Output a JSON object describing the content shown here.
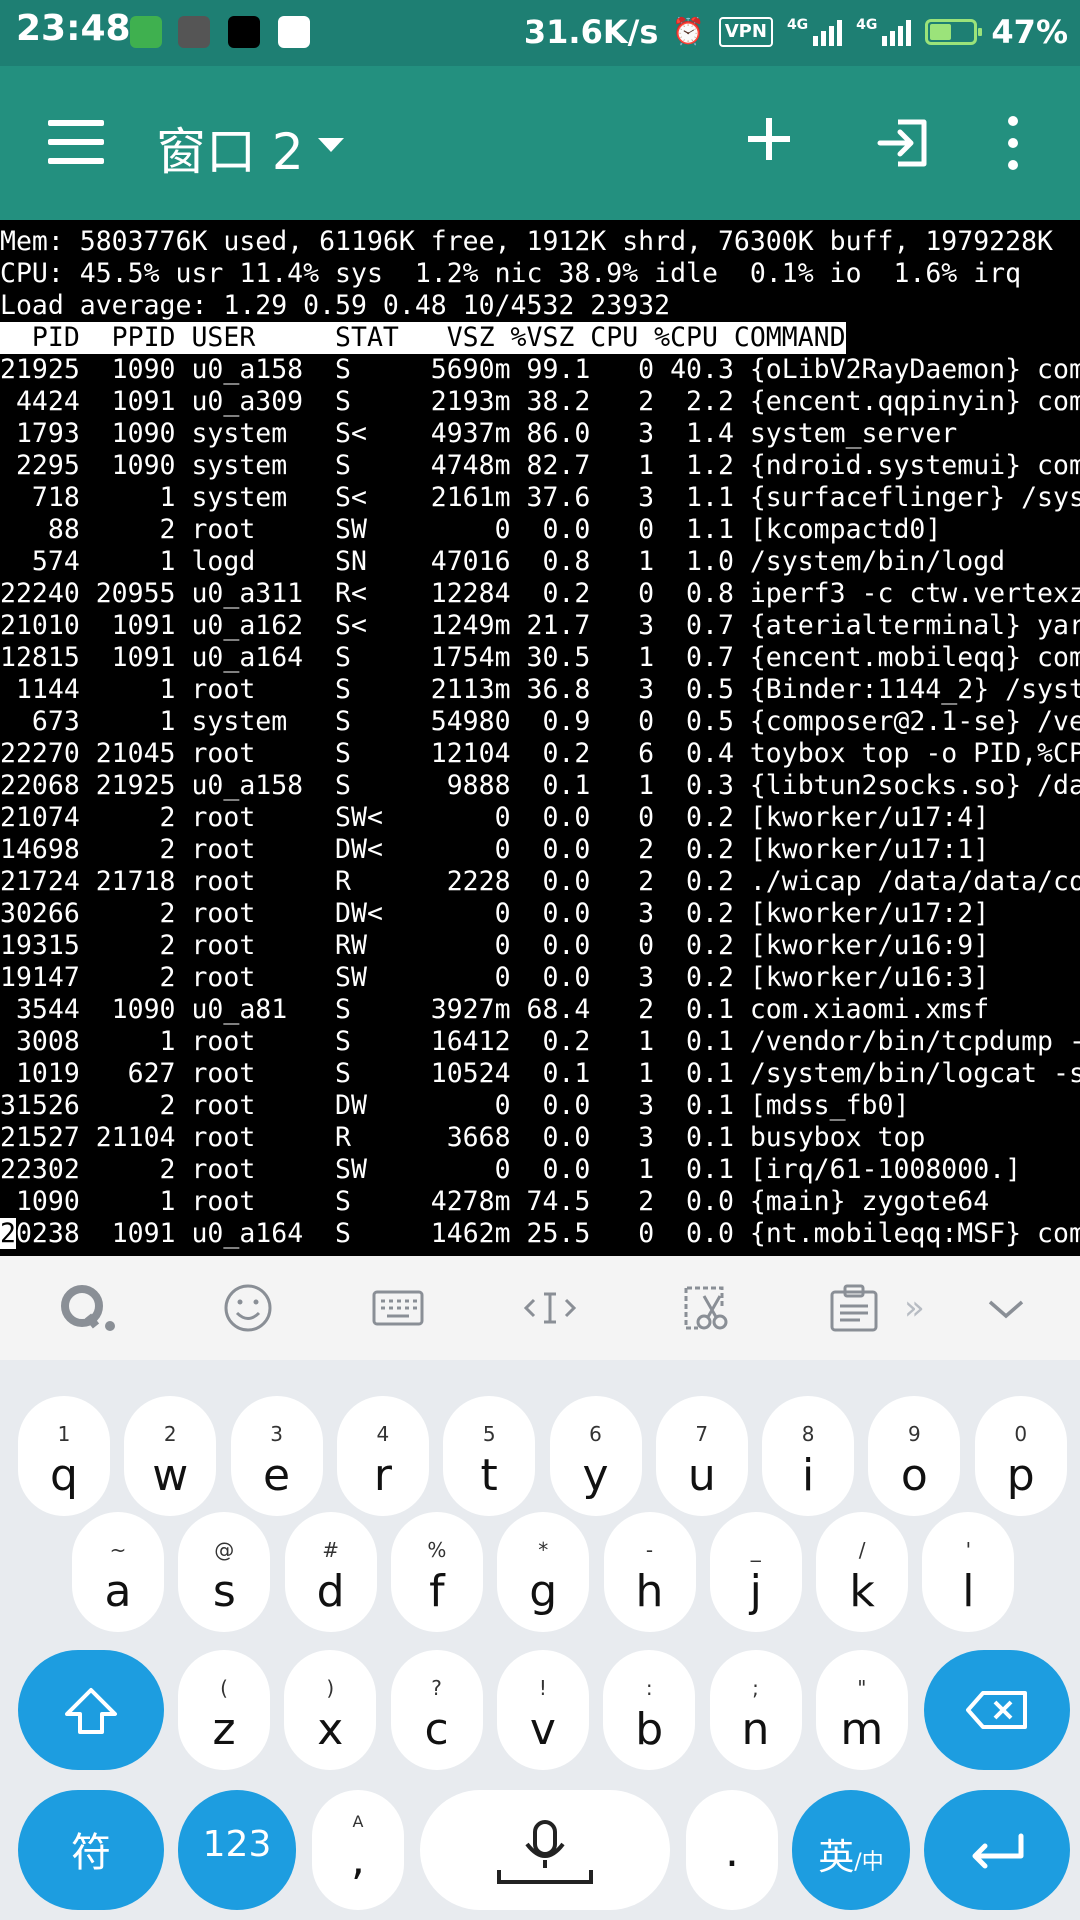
{
  "status_bar": {
    "time": "23:48",
    "network_speed": "31.6K/s",
    "vpn": "VPN",
    "sim1": "4G",
    "sim2": "4G",
    "battery": "47%",
    "battery_level": 0.47
  },
  "toolbar": {
    "title": "窗口 2"
  },
  "terminal": {
    "mem_line": "Mem: 5803776K used, 61196K free, 1912K shrd, 76300K buff, 1979228K",
    "cpu_line": "CPU: 45.5% usr 11.4% sys  1.2% nic 38.9% idle  0.1% io  1.6% irq",
    "load_line": "Load average: 1.29 0.59 0.48 10/4532 23932",
    "header": "  PID  PPID USER     STAT   VSZ %VSZ CPU %CPU COMMAND",
    "rows": [
      "21925  1090 u0_a158  S     5690m 99.1   0 40.3 {oLibV2RayDaemon} com",
      " 4424  1091 u0_a309  S     2193m 38.2   2  2.2 {encent.qqpinyin} com",
      " 1793  1090 system   S<    4937m 86.0   3  1.4 system_server",
      " 2295  1090 system   S     4748m 82.7   1  1.2 {ndroid.systemui} com",
      "  718     1 system   S<    2161m 37.6   3  1.1 {surfaceflinger} /sys",
      "   88     2 root     SW        0  0.0   0  1.1 [kcompactd0]",
      "  574     1 logd     SN    47016  0.8   1  1.0 /system/bin/logd",
      "22240 20955 u0_a311  R<    12284  0.2   0  0.8 iperf3 -c ctw.vertexz",
      "21010  1091 u0_a162  S<    1249m 21.7   3  0.7 {aterialterminal} yar",
      "12815  1091 u0_a164  S     1754m 30.5   1  0.7 {encent.mobileqq} com",
      " 1144     1 root     S     2113m 36.8   3  0.5 {Binder:1144_2} /syst",
      "  673     1 system   S     54980  0.9   0  0.5 {composer@2.1-se} /ve",
      "22270 21045 root     S     12104  0.2   6  0.4 toybox top -o PID,%CP",
      "22068 21925 u0_a158  S      9888  0.1   1  0.3 {libtun2socks.so} /da",
      "21074     2 root     SW<       0  0.0   0  0.2 [kworker/u17:4]",
      "14698     2 root     DW<       0  0.0   2  0.2 [kworker/u17:1]",
      "21724 21718 root     R      2228  0.0   2  0.2 ./wicap /data/data/co",
      "30266     2 root     DW<       0  0.0   3  0.2 [kworker/u17:2]",
      "19315     2 root     RW        0  0.0   0  0.2 [kworker/u16:9]",
      "19147     2 root     SW        0  0.0   3  0.2 [kworker/u16:3]",
      " 3544  1090 u0_a81   S     3927m 68.4   2  0.1 com.xiaomi.xmsf",
      " 3008     1 root     S     16412  0.2   1  0.1 /vendor/bin/tcpdump -",
      " 1019   627 root     S     10524  0.1   1  0.1 /system/bin/logcat -s",
      "31526     2 root     DW        0  0.0   3  0.1 [mdss_fb0]",
      "21527 21104 root     R      3668  0.0   3  0.1 busybox top",
      "22302     2 root     SW        0  0.0   1  0.1 [irq/61-1008000.]",
      " 1090     1 root     S     4278m 74.5   2  0.0 {main} zygote64"
    ],
    "last_row_cursor": "2",
    "last_row_rest": "0238  1091 u0_a164  S     1462m 25.5   0  0.0 {nt.mobileqq:MSF} com"
  },
  "keyboard": {
    "row1": [
      {
        "sub": "1",
        "key": "q"
      },
      {
        "sub": "2",
        "key": "w"
      },
      {
        "sub": "3",
        "key": "e"
      },
      {
        "sub": "4",
        "key": "r"
      },
      {
        "sub": "5",
        "key": "t"
      },
      {
        "sub": "6",
        "key": "y"
      },
      {
        "sub": "7",
        "key": "u"
      },
      {
        "sub": "8",
        "key": "i"
      },
      {
        "sub": "9",
        "key": "o"
      },
      {
        "sub": "0",
        "key": "p"
      }
    ],
    "row2": [
      {
        "sub": "~",
        "key": "a"
      },
      {
        "sub": "@",
        "key": "s"
      },
      {
        "sub": "#",
        "key": "d"
      },
      {
        "sub": "%",
        "key": "f"
      },
      {
        "sub": "*",
        "key": "g"
      },
      {
        "sub": "-",
        "key": "h"
      },
      {
        "sub": "_",
        "key": "j"
      },
      {
        "sub": "/",
        "key": "k"
      },
      {
        "sub": "'",
        "key": "l"
      }
    ],
    "row3": [
      {
        "sub": "(",
        "key": "z"
      },
      {
        "sub": ")",
        "key": "x"
      },
      {
        "sub": "?",
        "key": "c"
      },
      {
        "sub": "!",
        "key": "v"
      },
      {
        "sub": ":",
        "key": "b"
      },
      {
        "sub": ";",
        "key": "n"
      },
      {
        "sub": "\"",
        "key": "m"
      }
    ],
    "symbol_key": "符",
    "num_key": "123",
    "comma_key": ",",
    "comma_sub": "A",
    "period_key": ".",
    "lang_key": "英",
    "lang_sub": "/中"
  }
}
